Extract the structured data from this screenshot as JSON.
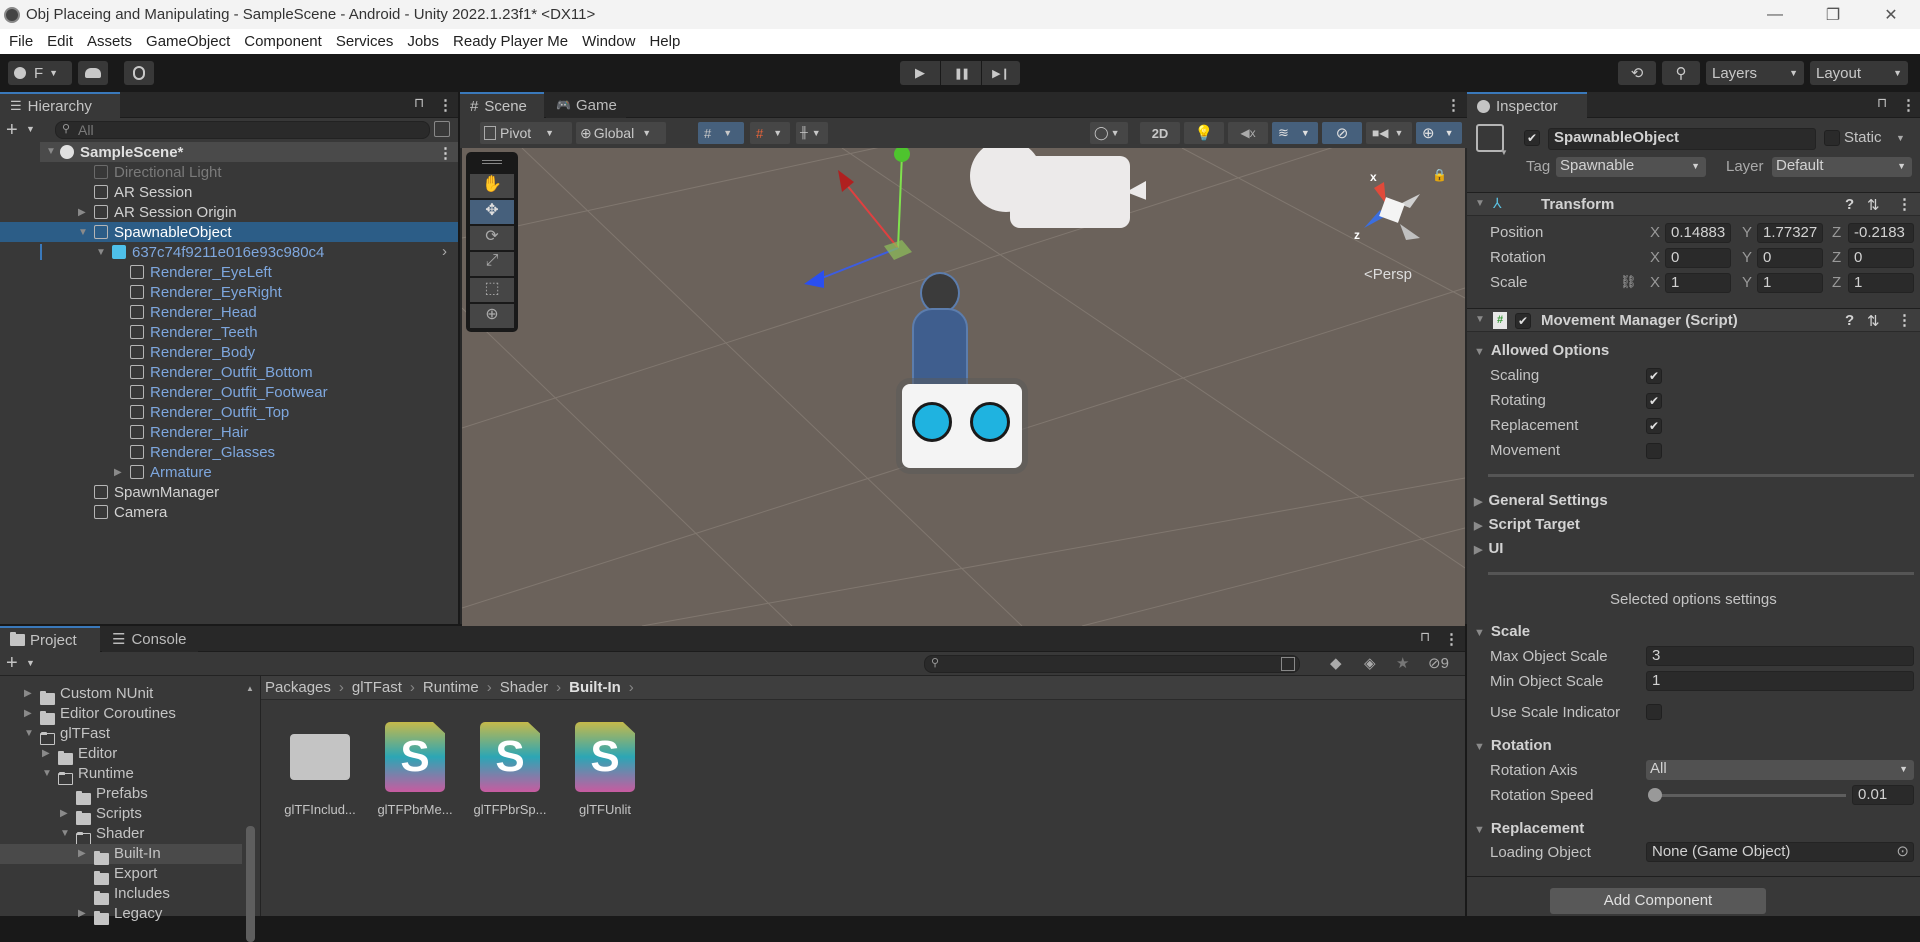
{
  "window": {
    "title": "Obj Placeing and Manipulating - SampleScene - Android - Unity 2022.1.23f1* <DX11>",
    "controls": {
      "minimize": "—",
      "maximize": "❐",
      "close": "✕"
    }
  },
  "menu": [
    "File",
    "Edit",
    "Assets",
    "GameObject",
    "Component",
    "Services",
    "Jobs",
    "Ready Player Me",
    "Window",
    "Help"
  ],
  "toolbar": {
    "account_label": "F",
    "play_icon": "▶",
    "pause_icon": "❚❚",
    "step_icon": "▶❙",
    "history_icon": "⟲",
    "search_icon": "⚲",
    "layers_label": "Layers",
    "layout_label": "Layout"
  },
  "hierarchy": {
    "tab_label": "Hierarchy",
    "search_placeholder": "All",
    "scene_name": "SampleScene*",
    "items": [
      {
        "label": "Directional Light",
        "depth": 1,
        "expander": "",
        "style": "disabled"
      },
      {
        "label": "AR Session",
        "depth": 1,
        "expander": "",
        "style": "normal"
      },
      {
        "label": "AR Session Origin",
        "depth": 1,
        "expander": "▶",
        "style": "normal"
      },
      {
        "label": "SpawnableObject",
        "depth": 1,
        "expander": "▼",
        "style": "selected"
      },
      {
        "label": "637c74f9211e016e93c980c4",
        "depth": 2,
        "expander": "▼",
        "style": "prefab-root"
      },
      {
        "label": "Renderer_EyeLeft",
        "depth": 3,
        "expander": "",
        "style": "prefab"
      },
      {
        "label": "Renderer_EyeRight",
        "depth": 3,
        "expander": "",
        "style": "prefab"
      },
      {
        "label": "Renderer_Head",
        "depth": 3,
        "expander": "",
        "style": "prefab"
      },
      {
        "label": "Renderer_Teeth",
        "depth": 3,
        "expander": "",
        "style": "prefab"
      },
      {
        "label": "Renderer_Body",
        "depth": 3,
        "expander": "",
        "style": "prefab"
      },
      {
        "label": "Renderer_Outfit_Bottom",
        "depth": 3,
        "expander": "",
        "style": "prefab"
      },
      {
        "label": "Renderer_Outfit_Footwear",
        "depth": 3,
        "expander": "",
        "style": "prefab"
      },
      {
        "label": "Renderer_Outfit_Top",
        "depth": 3,
        "expander": "",
        "style": "prefab"
      },
      {
        "label": "Renderer_Hair",
        "depth": 3,
        "expander": "",
        "style": "prefab"
      },
      {
        "label": "Renderer_Glasses",
        "depth": 3,
        "expander": "",
        "style": "prefab"
      },
      {
        "label": "Armature",
        "depth": 3,
        "expander": "▶",
        "style": "prefab"
      },
      {
        "label": "SpawnManager",
        "depth": 1,
        "expander": "",
        "style": "normal"
      },
      {
        "label": "Camera",
        "depth": 1,
        "expander": "",
        "style": "normal"
      }
    ]
  },
  "scene": {
    "tabs": [
      "Scene",
      "Game"
    ],
    "pivot_label": "Pivot",
    "global_label": "Global",
    "mode_2d_label": "2D",
    "persp_label": "<Persp",
    "gizmo_x": "x",
    "gizmo_z": "z",
    "tools": [
      "hand-tool",
      "move-tool",
      "rotate-tool",
      "scale-tool",
      "rect-tool",
      "transform-tool"
    ],
    "active_tool": "move-tool"
  },
  "inspector": {
    "tab_label": "Inspector",
    "object_name": "SpawnableObject",
    "active": true,
    "static_label": "Static",
    "tag_label": "Tag",
    "tag_value": "Spawnable",
    "layer_label": "Layer",
    "layer_value": "Default",
    "transform": {
      "title": "Transform",
      "position": {
        "label": "Position",
        "x": "0.14883",
        "y": "1.77327",
        "z": "-0.2183"
      },
      "rotation": {
        "label": "Rotation",
        "x": "0",
        "y": "0",
        "z": "0"
      },
      "scale": {
        "label": "Scale",
        "x": "1",
        "y": "1",
        "z": "1"
      },
      "axis_labels": {
        "x": "X",
        "y": "Y",
        "z": "Z"
      }
    },
    "movement_manager": {
      "title": "Movement Manager (Script)",
      "enabled": true,
      "allowed_options": {
        "title": "Allowed Options",
        "items": [
          {
            "label": "Scaling",
            "checked": true
          },
          {
            "label": "Rotating",
            "checked": true
          },
          {
            "label": "Replacement",
            "checked": true
          },
          {
            "label": "Movement",
            "checked": false
          }
        ]
      },
      "collapsed_sections": [
        "General Settings",
        "Script Target",
        "UI"
      ],
      "selected_options_heading": "Selected options settings",
      "scale": {
        "title": "Scale",
        "max_label": "Max Object Scale",
        "max_value": "3",
        "min_label": "Min Object Scale",
        "min_value": "1",
        "indicator_label": "Use Scale Indicator",
        "indicator_checked": false
      },
      "rotation": {
        "title": "Rotation",
        "axis_label": "Rotation Axis",
        "axis_value": "All",
        "speed_label": "Rotation Speed",
        "speed_value": "0.01"
      },
      "replacement": {
        "title": "Replacement",
        "loading_label": "Loading Object",
        "loading_value": "None (Game Object)"
      }
    },
    "add_component_label": "Add Component"
  },
  "project": {
    "tabs": [
      "Project",
      "Console"
    ],
    "hidden_count": "9",
    "tree": [
      {
        "label": "Custom NUnit",
        "depth": 0,
        "expander": "▶",
        "open": false
      },
      {
        "label": "Editor Coroutines",
        "depth": 0,
        "expander": "▶",
        "open": false
      },
      {
        "label": "glTFast",
        "depth": 0,
        "expander": "▼",
        "open": true
      },
      {
        "label": "Editor",
        "depth": 1,
        "expander": "▶",
        "open": false
      },
      {
        "label": "Runtime",
        "depth": 1,
        "expander": "▼",
        "open": true
      },
      {
        "label": "Prefabs",
        "depth": 2,
        "expander": "",
        "open": false
      },
      {
        "label": "Scripts",
        "depth": 2,
        "expander": "▶",
        "open": false
      },
      {
        "label": "Shader",
        "depth": 2,
        "expander": "▼",
        "open": true
      },
      {
        "label": "Built-In",
        "depth": 3,
        "expander": "▶",
        "open": false,
        "selected": true
      },
      {
        "label": "Export",
        "depth": 3,
        "expander": "",
        "open": false
      },
      {
        "label": "Includes",
        "depth": 3,
        "expander": "",
        "open": false
      },
      {
        "label": "Legacy",
        "depth": 3,
        "expander": "▶",
        "open": false
      }
    ],
    "breadcrumb": [
      "Packages",
      "glTFast",
      "Runtime",
      "Shader",
      "Built-In"
    ],
    "assets": [
      {
        "label": "glTFInclud...",
        "type": "folder"
      },
      {
        "label": "glTFPbrMe...",
        "type": "shader"
      },
      {
        "label": "glTFPbrSp...",
        "type": "shader"
      },
      {
        "label": "glTFUnlit",
        "type": "shader"
      }
    ]
  },
  "colors": {
    "selection": "#2c5d87",
    "prefab_text": "#7ea7de",
    "active_tab_accent": "#3a79bb",
    "scene_bg": "#6b625b"
  }
}
